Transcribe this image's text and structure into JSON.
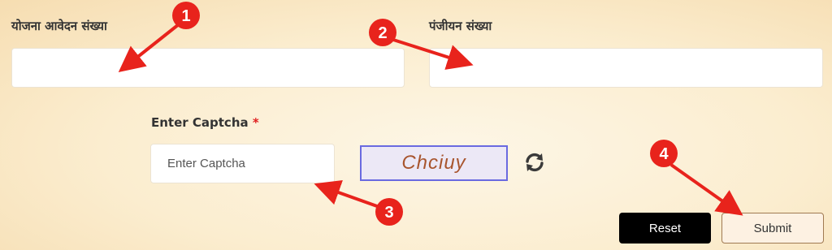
{
  "form": {
    "application_no_label": "योजना आवेदन संख्या",
    "registration_no_label": "पंजीयन संख्या",
    "captcha_label": "Enter Captcha",
    "captcha_required_mark": "*",
    "captcha_placeholder": "Enter Captcha",
    "captcha_image_text": "Chciuy",
    "refresh_icon": "refresh-icon"
  },
  "buttons": {
    "reset_label": "Reset",
    "submit_label": "Submit"
  },
  "annotations": {
    "badge_1": "1",
    "badge_2": "2",
    "badge_3": "3",
    "badge_4": "4",
    "color": "#e8231c"
  }
}
